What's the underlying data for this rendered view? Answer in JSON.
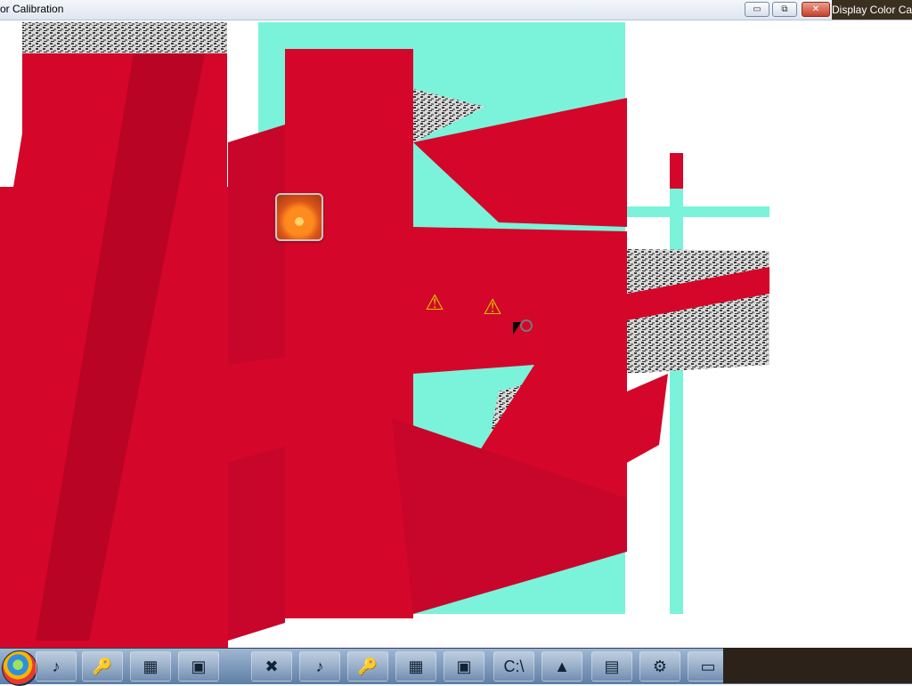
{
  "window": {
    "title": "or Calibration",
    "second_title": "Display Color Cali",
    "minimize_label": "▭",
    "restore_label": "⧉",
    "close_label": "✕"
  },
  "icons": {
    "app": "photo-gallery-icon",
    "warning_1": "warning-icon",
    "warning_2": "warning-icon"
  },
  "taskbar": {
    "items": [
      {
        "name": "windows-media-player",
        "glyph": "♪"
      },
      {
        "name": "keys",
        "glyph": "🔑"
      },
      {
        "name": "calculator",
        "glyph": "▦"
      },
      {
        "name": "window-app",
        "glyph": "▣"
      },
      {
        "name": "xbox",
        "glyph": "✖"
      },
      {
        "name": "media-player-2",
        "glyph": "♪"
      },
      {
        "name": "keys-2",
        "glyph": "🔑"
      },
      {
        "name": "calculator-2",
        "glyph": "▦"
      },
      {
        "name": "window-app-2",
        "glyph": "▣"
      },
      {
        "name": "command-prompt",
        "glyph": "C:\\"
      },
      {
        "name": "installer",
        "glyph": "▲"
      },
      {
        "name": "documents",
        "glyph": "▤"
      },
      {
        "name": "settings",
        "glyph": "⚙"
      },
      {
        "name": "drive",
        "glyph": "▭"
      },
      {
        "name": "media-player-3",
        "glyph": "♪"
      },
      {
        "name": "video-player",
        "glyph": "▶"
      },
      {
        "name": "browser",
        "glyph": "◉"
      },
      {
        "name": "pinwheel-app",
        "glyph": "✿"
      }
    ]
  },
  "colors": {
    "red": "#d4062a",
    "cyan": "#7af3da",
    "taskbar": "#6d8bb0"
  }
}
